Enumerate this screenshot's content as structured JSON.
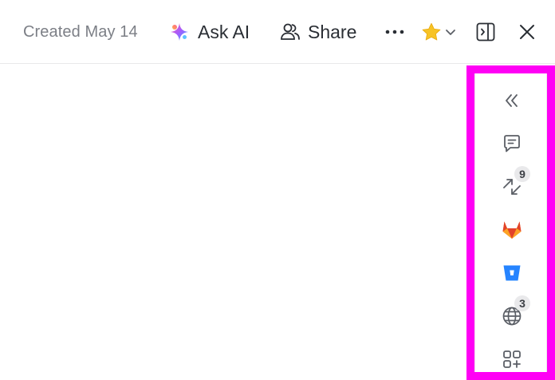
{
  "header": {
    "created_text": "Created May 14",
    "ask_ai_label": "Ask AI",
    "share_label": "Share",
    "icons": [
      "ai-sparkle-icon",
      "share-people-icon",
      "more-horizontal-icon",
      "star-icon",
      "chevron-down-icon",
      "sidebar-panel-icon",
      "close-icon"
    ]
  },
  "sidebar": {
    "items": [
      {
        "icon": "collapse-double-chevron-icon"
      },
      {
        "icon": "comment-icon"
      },
      {
        "icon": "relationships-arrows-icon",
        "badge": "9"
      },
      {
        "icon": "gitlab-icon"
      },
      {
        "icon": "bitbucket-icon"
      },
      {
        "icon": "globe-icon",
        "badge": "3"
      },
      {
        "icon": "add-apps-icon"
      }
    ]
  },
  "colors": {
    "highlight": "#ff00f5",
    "star": "#f7c325",
    "gitlab": "#fc6d26",
    "bitbucket": "#2684ff",
    "icon_gray": "#5b5f66"
  }
}
